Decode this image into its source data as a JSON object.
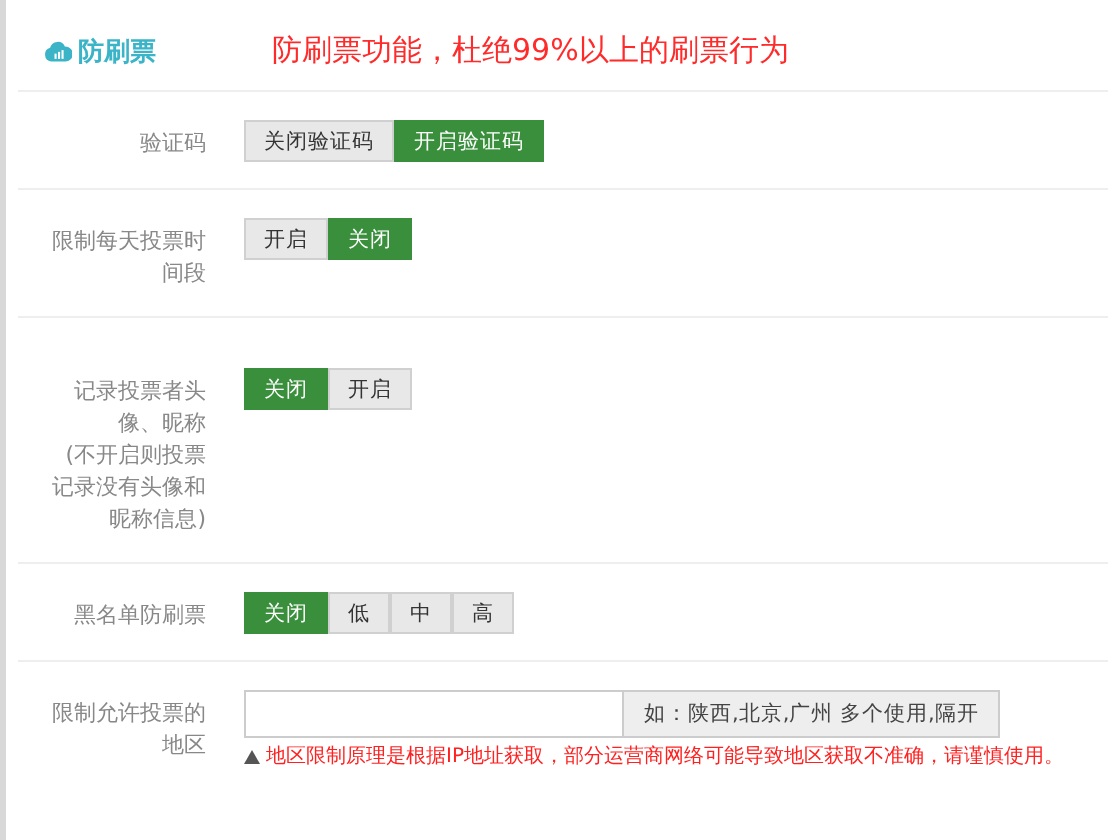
{
  "header": {
    "title": "防刷票",
    "notice": "防刷票功能，杜绝99%以上的刷票行为"
  },
  "groups": [
    [
      {
        "kind": "toggle",
        "label": "验证码",
        "options": [
          {
            "label": "关闭验证码",
            "selected": false
          },
          {
            "label": "开启验证码",
            "selected": true
          }
        ]
      },
      {
        "kind": "toggle",
        "label": "限制每天投票时间段",
        "options": [
          {
            "label": "开启",
            "selected": false
          },
          {
            "label": "关闭",
            "selected": true
          }
        ]
      }
    ],
    [
      {
        "kind": "toggle",
        "label": "记录投票者头像、昵称",
        "note": "(不开启则投票记录没有头像和昵称信息)",
        "options": [
          {
            "label": "关闭",
            "selected": true
          },
          {
            "label": "开启",
            "selected": false
          }
        ]
      },
      {
        "kind": "toggle",
        "label": "黑名单防刷票",
        "options": [
          {
            "label": "关闭",
            "selected": true
          },
          {
            "label": "低",
            "selected": false
          },
          {
            "label": "中",
            "selected": false
          },
          {
            "label": "高",
            "selected": false
          }
        ]
      },
      {
        "kind": "region",
        "label": "限制允许投票的地区",
        "addon": "如：陕西,北京,广州 多个使用,隔开",
        "hint": "地区限制原理是根据IP地址获取，部分运营商网络可能导致地区获取不准确，请谨慎使用。"
      }
    ]
  ]
}
